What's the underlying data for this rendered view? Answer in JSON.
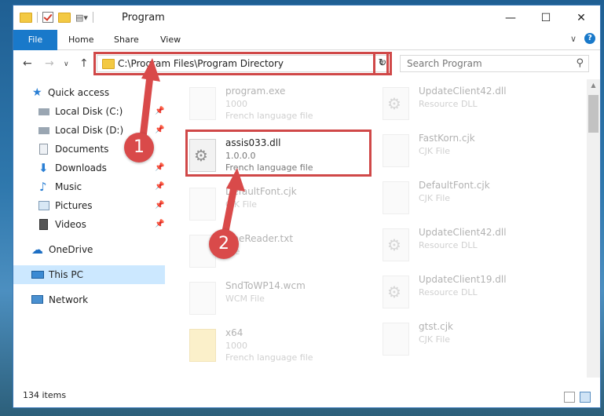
{
  "window": {
    "title": "Program"
  },
  "ribbon": {
    "tabs": [
      "File",
      "Home",
      "Share",
      "View"
    ],
    "help": "?"
  },
  "address": {
    "path": "C:\\Program Files\\Program Directory"
  },
  "search": {
    "placeholder": "Search Program"
  },
  "sidebar": {
    "items": [
      {
        "label": "Quick access"
      },
      {
        "label": "Local Disk (C:)"
      },
      {
        "label": "Local Disk (D:)"
      },
      {
        "label": "Documents"
      },
      {
        "label": "Downloads"
      },
      {
        "label": "Music"
      },
      {
        "label": "Pictures"
      },
      {
        "label": "Videos"
      },
      {
        "label": "OneDrive"
      },
      {
        "label": "This PC"
      },
      {
        "label": "Network"
      }
    ]
  },
  "files": {
    "left": [
      {
        "name": "program.exe",
        "line2": "1000",
        "line3": "French language file"
      },
      {
        "name": "assis033.dll",
        "line2": "1.0.0.0",
        "line3": "French language file"
      },
      {
        "name": "DefaultFont.cjk",
        "line2": "CJK File"
      },
      {
        "name": "FineReader.txt",
        "line2": "File"
      },
      {
        "name": "SndToWP14.wcm",
        "line2": "WCM File"
      },
      {
        "name": "x64",
        "line2": "1000",
        "line3": "French language file"
      }
    ],
    "right": [
      {
        "name": "UpdateClient42.dll",
        "line2": "Resource DLL"
      },
      {
        "name": "FastKorn.cjk",
        "line2": "CJK File"
      },
      {
        "name": "DefaultFont.cjk",
        "line2": "CJK File"
      },
      {
        "name": "UpdateClient42.dll",
        "line2": "Resource DLL"
      },
      {
        "name": "UpdateClient19.dll",
        "line2": "Resource DLL"
      },
      {
        "name": "gtst.cjk",
        "line2": "CJK File"
      }
    ]
  },
  "status": {
    "count": "134 items"
  },
  "callouts": {
    "one": "1",
    "two": "2"
  },
  "colors": {
    "accent": "#1979ca",
    "highlight": "#d04848",
    "selected": "#cce8ff"
  }
}
